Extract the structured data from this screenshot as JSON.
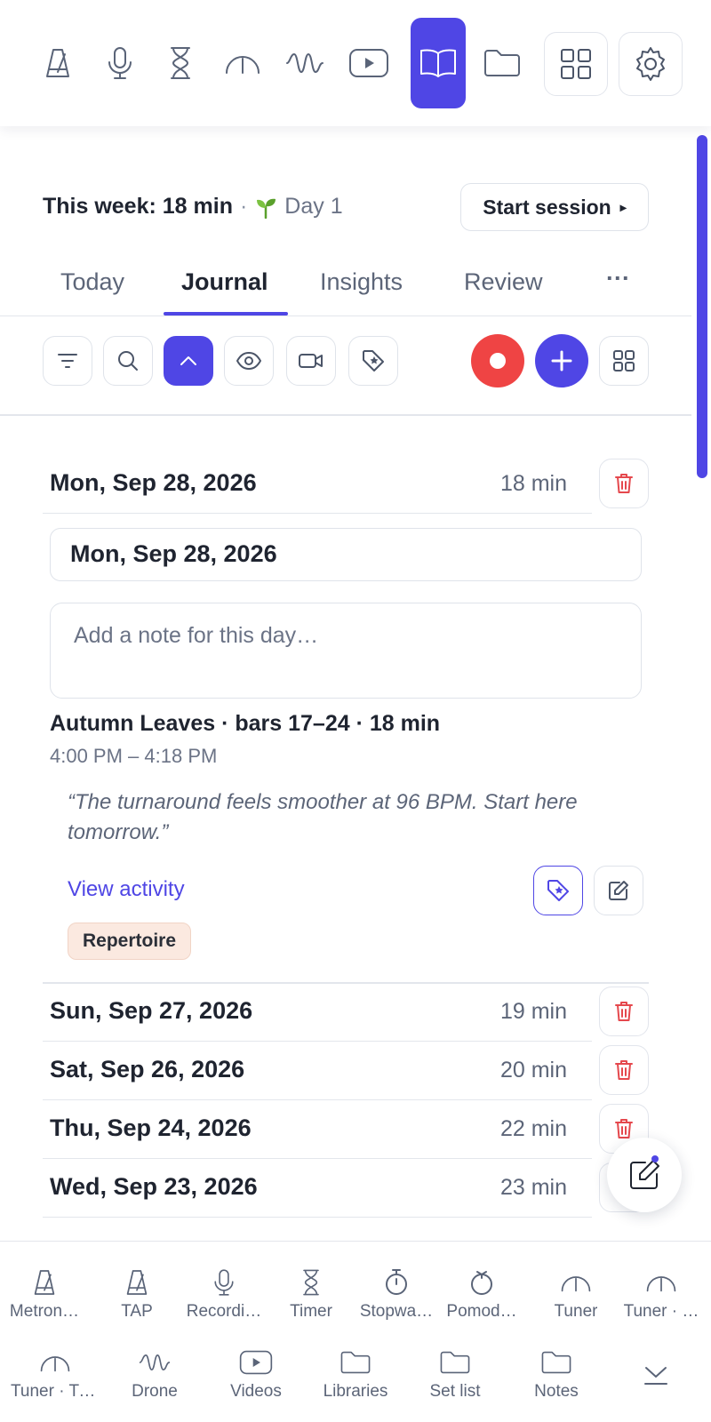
{
  "toolbar": {
    "icons": [
      "metronome-icon",
      "microphone-icon",
      "hourglass-icon",
      "tuner-gauge-icon",
      "waveform-icon",
      "video-play-icon",
      "journal-book-icon",
      "folder-icon",
      "grid-icon",
      "gear-icon"
    ],
    "active": "journal-book-icon"
  },
  "summary": {
    "week_label": "This week: 18 min",
    "separator": "·",
    "streak_label": "Day 1",
    "start_button": "Start session",
    "start_button_caret": "▸"
  },
  "tabs": [
    {
      "label": "Today"
    },
    {
      "label": "Journal",
      "active": true
    },
    {
      "label": "Insights"
    },
    {
      "label": "Review"
    },
    {
      "label": "···"
    }
  ],
  "actions": [
    "filter-icon",
    "search-icon",
    "collapse-icon",
    "eye-icon",
    "video-camera-icon",
    "tag-star-icon",
    "record-icon",
    "add-icon",
    "grid-view-icon"
  ],
  "entries": [
    {
      "date": "Mon, Sep 28, 2026",
      "duration": "18 min",
      "expanded": true
    },
    {
      "date": "Sun, Sep 27, 2026",
      "duration": "19 min"
    },
    {
      "date": "Sat, Sep 26, 2026",
      "duration": "20 min"
    },
    {
      "date": "Thu, Sep 24, 2026",
      "duration": "22 min"
    },
    {
      "date": "Wed, Sep 23, 2026",
      "duration": "23 min"
    }
  ],
  "expanded_entry": {
    "date_field": "Mon, Sep 28, 2026",
    "note_placeholder": "Add a note for this day…",
    "activity_title": "Autumn Leaves · bars 17–24 · 18 min",
    "activity_time": "4:00 PM – 4:18 PM",
    "quote": "“The turnaround feels smoother at 96 BPM. Start here tomorrow.”",
    "view_link": "View activity",
    "tag": "Repertoire"
  },
  "dock": {
    "row1": [
      {
        "icon": "metronome-icon",
        "label": "Metron…"
      },
      {
        "icon": "metronome-icon",
        "label": "TAP"
      },
      {
        "icon": "microphone-icon",
        "label": "Recordi…"
      },
      {
        "icon": "hourglass-icon",
        "label": "Timer"
      },
      {
        "icon": "stopwatch-icon",
        "label": "Stopwa…"
      },
      {
        "icon": "tomato-timer-icon",
        "label": "Pomod…"
      },
      {
        "icon": "tuner-gauge-icon",
        "label": "Tuner"
      },
      {
        "icon": "tuner-gauge-icon",
        "label": "Tuner · …"
      }
    ],
    "row2": [
      {
        "icon": "tuner-gauge-icon",
        "label": "Tuner · Tr…"
      },
      {
        "icon": "waveform-icon",
        "label": "Drone"
      },
      {
        "icon": "video-play-icon",
        "label": "Videos"
      },
      {
        "icon": "folder-icon",
        "label": "Libraries"
      },
      {
        "icon": "folder-icon",
        "label": "Set list"
      },
      {
        "icon": "folder-icon",
        "label": "Notes"
      }
    ]
  },
  "colors": {
    "accent": "#4f46e5",
    "record": "#ef4444",
    "trash": "#e5484d",
    "tag_bg": "#fbe9e0"
  }
}
